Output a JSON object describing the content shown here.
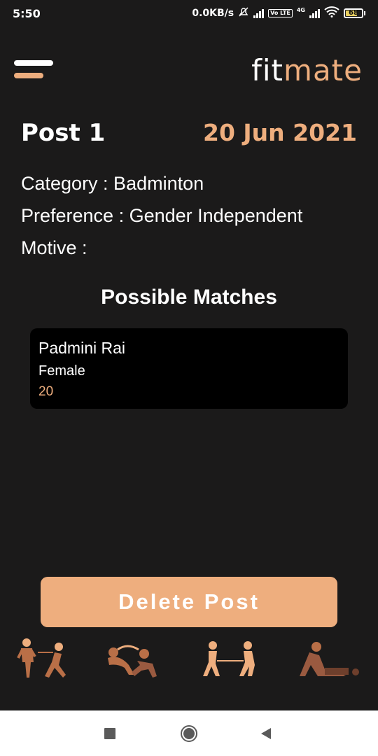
{
  "status_bar": {
    "time": "5:50",
    "network_speed": "0.0KB/s",
    "volte_label": "Vo LTE",
    "network_type": "4G",
    "battery_level": "68"
  },
  "header": {
    "logo_part1": "fit",
    "logo_part2": "mate"
  },
  "post": {
    "title": "Post 1",
    "date": "20 Jun 2021",
    "category_line": "Category : Badminton",
    "preference_line": "Preference : Gender Independent",
    "motive_line": "Motive :"
  },
  "matches": {
    "heading": "Possible Matches",
    "items": [
      {
        "name": "Padmini Rai",
        "gender": "Female",
        "age": "20"
      }
    ]
  },
  "actions": {
    "delete_label": "Delete Post"
  },
  "colors": {
    "background": "#1b1a1a",
    "accent": "#eeae7e",
    "card": "#000000",
    "figure": "#9a5a40"
  },
  "icons": [
    "menu-icon",
    "runner-illustration",
    "yoga-illustration",
    "tug-of-war-illustration",
    "pushup-illustration",
    "recent-apps-icon",
    "home-icon",
    "back-icon"
  ]
}
